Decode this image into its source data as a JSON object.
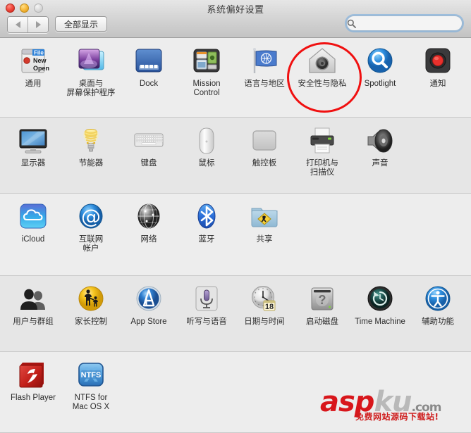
{
  "window": {
    "title": "系统偏好设置",
    "traffic_lights": [
      {
        "name": "close",
        "color": "#f24d41"
      },
      {
        "name": "minimize",
        "color": "#f9bc3f"
      },
      {
        "name": "zoom",
        "color": "#dcdcdc"
      }
    ]
  },
  "toolbar": {
    "back_label": "◀",
    "forward_label": "▶",
    "show_all_label": "全部显示",
    "search": {
      "value": "",
      "placeholder": "",
      "icon": "search-icon"
    }
  },
  "highlight": {
    "target": "安全性与隐私",
    "color": "#f01010",
    "shape": "ellipse"
  },
  "watermark": {
    "brand_red": "asp",
    "brand_gray": "ku",
    "domain": ".com",
    "subtitle": "免费网站源码下载站!",
    "red": "#d8161b",
    "gray": "#b9b9b9"
  },
  "rows": [
    {
      "index": 0,
      "items": [
        {
          "label": "通用",
          "icon": "general-window-icon"
        },
        {
          "label": "桌面与\n屏幕保护程序",
          "icon": "desktop-screensaver-icon"
        },
        {
          "label": "Dock",
          "icon": "dock-icon"
        },
        {
          "label": "Mission\nControl",
          "icon": "mission-control-icon"
        },
        {
          "label": "语言与地区",
          "icon": "language-region-flag-icon"
        },
        {
          "label": "安全性与隐私",
          "icon": "security-privacy-house-icon"
        },
        {
          "label": "Spotlight",
          "icon": "spotlight-magnifier-icon"
        },
        {
          "label": "通知",
          "icon": "notifications-icon"
        }
      ]
    },
    {
      "index": 1,
      "items": [
        {
          "label": "显示器",
          "icon": "displays-monitor-icon"
        },
        {
          "label": "节能器",
          "icon": "energy-saver-bulb-icon"
        },
        {
          "label": "键盘",
          "icon": "keyboard-icon"
        },
        {
          "label": "鼠标",
          "icon": "mouse-icon"
        },
        {
          "label": "触控板",
          "icon": "trackpad-icon"
        },
        {
          "label": "打印机与\n扫描仪",
          "icon": "printers-scanners-icon"
        },
        {
          "label": "声音",
          "icon": "sound-speaker-icon"
        }
      ]
    },
    {
      "index": 2,
      "items": [
        {
          "label": "iCloud",
          "icon": "icloud-icon"
        },
        {
          "label": "互联网\n帐户",
          "icon": "internet-accounts-at-icon"
        },
        {
          "label": "网络",
          "icon": "network-globe-icon"
        },
        {
          "label": "蓝牙",
          "icon": "bluetooth-icon"
        },
        {
          "label": "共享",
          "icon": "sharing-folder-icon"
        }
      ]
    },
    {
      "index": 3,
      "items": [
        {
          "label": "用户与群组",
          "icon": "users-groups-icon"
        },
        {
          "label": "家长控制",
          "icon": "parental-controls-icon"
        },
        {
          "label": "App Store",
          "icon": "app-store-icon"
        },
        {
          "label": "听写与语音",
          "icon": "dictation-speech-mic-icon"
        },
        {
          "label": "日期与时间",
          "icon": "date-time-clock-icon"
        },
        {
          "label": "启动磁盘",
          "icon": "startup-disk-icon"
        },
        {
          "label": "Time Machine",
          "icon": "time-machine-icon"
        },
        {
          "label": "辅助功能",
          "icon": "accessibility-icon"
        }
      ]
    },
    {
      "index": 4,
      "items": [
        {
          "label": "Flash Player",
          "icon": "flash-player-icon"
        },
        {
          "label": "NTFS for\nMac OS X",
          "icon": "ntfs-mac-icon"
        }
      ]
    }
  ],
  "icon_extras": {
    "general_menu": [
      "File",
      "New",
      "Open"
    ],
    "calendar_day": "18",
    "ntfs_text": "NTFS"
  }
}
